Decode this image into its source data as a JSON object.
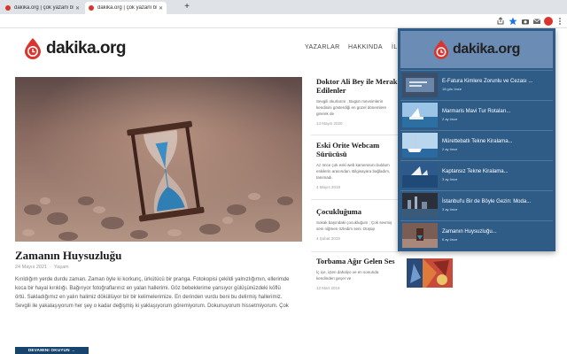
{
  "browser": {
    "tabs": [
      {
        "title": "dakika.org | çok yazarlı blog"
      },
      {
        "title": "dakika.org | çok yazarlı blog"
      }
    ],
    "new_tab": "+",
    "close": "✕"
  },
  "site": {
    "logo": "dakika.org",
    "nav": [
      "YAZARLAR",
      "HAKKINDA",
      "İL"
    ]
  },
  "featured": {
    "title": "Zamanın Huysuzluğu",
    "date": "24 Mayıs 2021",
    "category": "Yaşam",
    "excerpt": "Kırıldığım yerde durdu zaman. Zaman öyle ki korkunç, ürkütücü bir prangа. Fotokopisi çekildi yalnızlığımın, ellerimde koca bir hayal kırıklığı. Bağırıyor fotoğraflarınız en yalan hallerimi. Göz bebeklerime yansıyor gülüşünüzdeki köflü örtü. Sakladığımız en yalın halimiz döküllüyor bir bir kelimelerimize. En derinden vurdu beni bu delirmiş hallerimiz. Sevgili ile yakalaşıyorum her şey o kadar değişmiş ki yaklaşıyorum göremiyorum. Dokunuyorum hissetmiyorum. Çok",
    "read_more": "DEVAMINI OKUYUN →"
  },
  "side_posts": [
    {
      "title": "Doktor Ali Bey ile Merak Edilenler",
      "excerpt": "Sevgili okurlarım , Bugün mevsimlerin kendisini gösterdiği en güzel dönemlere girerek de",
      "date": "14 Mayıs 2020"
    },
    {
      "title": "Eski Orite Webcam Sürücüsü",
      "excerpt": "Az önce çok eski web kamerasını buldum eskilerin arasından. Bilgisayara bağladım, tanımadı.",
      "date": "4 Mayıs 2019"
    },
    {
      "title": "Çocukluğuma",
      "excerpt": "Sokak başındaki çocukluğum ; Çok sevmiş seni niğmen özledim seni. Düşüp",
      "date": "4 Şubat 2019"
    },
    {
      "title": "Torbama Ağır Gelen Ses",
      "excerpt": "İç içe, içten dahalyo ve en sonunda kendinden geçer ve",
      "date": "12 Mart 2019"
    }
  ],
  "popup": {
    "logo": "dakika.org",
    "items": [
      {
        "title": "E-Fatura Kimlere Zorunlu ve Cezası ...",
        "date": "18 gün önce"
      },
      {
        "title": "Marmaris Mavi Tur Rotaları...",
        "date": "2 ay önce"
      },
      {
        "title": "Mürettebatlı Tekne Kiralama...",
        "date": "2 ay önce"
      },
      {
        "title": "Kaptansız Tekne Kiralama...",
        "date": "3 ay önce"
      },
      {
        "title": "İstanbul'u Bir de Böyle Gezin: Moda...",
        "date": "3 ay önce"
      },
      {
        "title": "Zamanın Huysuzluğu...",
        "date": "6 ay önce"
      }
    ]
  },
  "colors": {
    "brand_red": "#d9352e",
    "popup_bg": "#2f5c86",
    "button_bg": "#16446c"
  }
}
